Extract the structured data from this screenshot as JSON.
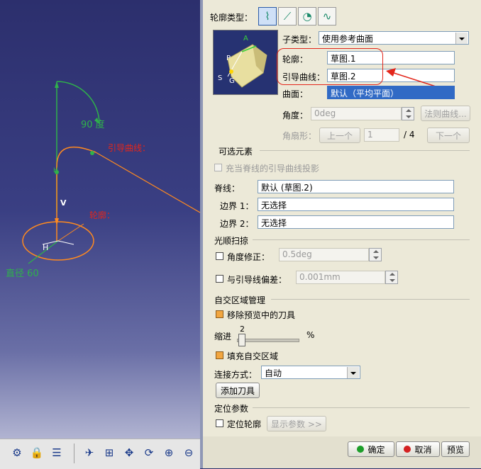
{
  "viewport": {
    "angle_label": "90 度",
    "guide_label": "引导曲线：",
    "profile_label": "轮廓：",
    "diameter_label": "直径 60",
    "v_label": "V",
    "h_label": "H",
    "vertical_h_label": "H",
    "colors": {
      "green": "#2fb24a",
      "orange": "#ff8a1f",
      "red": "#e3261b"
    }
  },
  "dialog": {
    "profile_type_label": "轮廓类型：",
    "subtype_label": "子类型：",
    "subtype_value": "使用参考曲面",
    "profile_label": "轮廓：",
    "profile_value": "草图.1",
    "guide_label": "引导曲线：",
    "guide_value": "草图.2",
    "surface_label": "曲面：",
    "surface_value": "默认（平均平面）",
    "angle_label": "角度：",
    "angle_value": "0deg",
    "law_button": "法则曲线...",
    "sector_label": "角扇形：",
    "prev_button": "上一个",
    "sector_value": "1",
    "sector_total": "/ 4",
    "next_button": "下一个",
    "optional_title": "可选元素",
    "project_guide_label": "充当脊线的引导曲线投影",
    "spine_label": "脊线：",
    "spine_value": "默认 (草图.2)",
    "boundary1_label": "边界 1：",
    "boundary1_value": "无选择",
    "boundary2_label": "边界 2：",
    "boundary2_value": "无选择",
    "smooth_title": "光顺扫掠",
    "angle_fix_label": "角度修正：",
    "angle_fix_value": "0.5deg",
    "deviation_label": "与引导线偏差：",
    "deviation_value": "0.001mm",
    "self_intersect_title": "自交区域管理",
    "remove_tools_label": "移除预览中的刀具",
    "indent_label": "缩进",
    "indent_value": "2",
    "indent_unit": "%",
    "indent_fraction": 0.02,
    "fill_label": "填充自交区域",
    "connect_label": "连接方式：",
    "connect_value": "自动",
    "add_tool_button": "添加刀具",
    "position_title": "定位参数",
    "position_profile_label": "定位轮廓",
    "show_params_button": "显示参数 >>",
    "ok_button": "确定",
    "cancel_button": "取消",
    "preview_button": "预览",
    "preview_labels": {
      "a": "A",
      "p": "P",
      "s": "S",
      "g": "G"
    }
  }
}
